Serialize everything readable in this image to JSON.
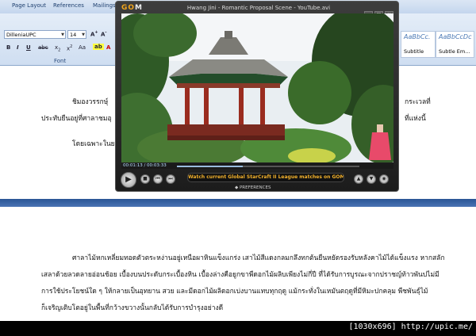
{
  "word": {
    "tabs": [
      "Page Layout",
      "References",
      "Mailings"
    ],
    "font_name": "DilleniaUPC",
    "font_size": "14",
    "font_group_label": "Font",
    "styles": [
      {
        "sample": "AaBbCc.",
        "name": "Subtitle"
      },
      {
        "sample": "AaBbCcDc",
        "name": "Subtle Em..."
      }
    ],
    "upper_lines": [
      "ชิมองวรรกษ์ุ",
      "ประทับยืนอยู่ที่ศาลาชมอุ",
      "โดยเฉพาะในย",
      "กระเวลที่",
      "ที่แห่งนี้"
    ],
    "lower_lines": [
      "ศาลาไม้หกเหลี่ยมทอดตัวตระหง่านอยู่เหนือผาหินแข็งแกร่ง เสาไม้สีแดงกลมกลึงทกต้นยืนหยัดรองรับหลังคาไม้ได้แข็งแรง หากสลัก",
      "เสลาด้วยลวดลายอ่อนช้อย เบื้องบนประดับกระเบื้องหิน เบื้องล่างคือยูกขาพืดอกไม้ผลิบเพียงไม่กี่ปี ที่ได้รับการบูรณะจากปราชญ์ท้าวพันปไม่มี",
      "การใช้ประโยชน์ใด ๆ ให้กลายเป็นอุทยาน สวย และมีดอกไม้ผลิดอกเบ่งบานแทบทุกฤดู แม้กระทั่งในเหมันตฤดูที่มีหิมะปกคลุม พืชพันธุ์ไม้",
      "ก็เจริญเติบโตอยู่ในพื้นที่กว้างขวางนั้นกลับได้รับการบำรุงอย่างดี"
    ]
  },
  "player": {
    "logo_g": "G",
    "logo_o": "O",
    "logo_m": "M",
    "title": "Hwang Jini - Romantic Proposal Scene - YouTube.avi",
    "time": "00:01:13 / 00:03:33",
    "progress": 0.36,
    "ticker": "Watch current Global StarCraft II League matches on GOM",
    "prefs_label": "PREFERENCES"
  },
  "footer": "[1030x696] http://upic.me/"
}
